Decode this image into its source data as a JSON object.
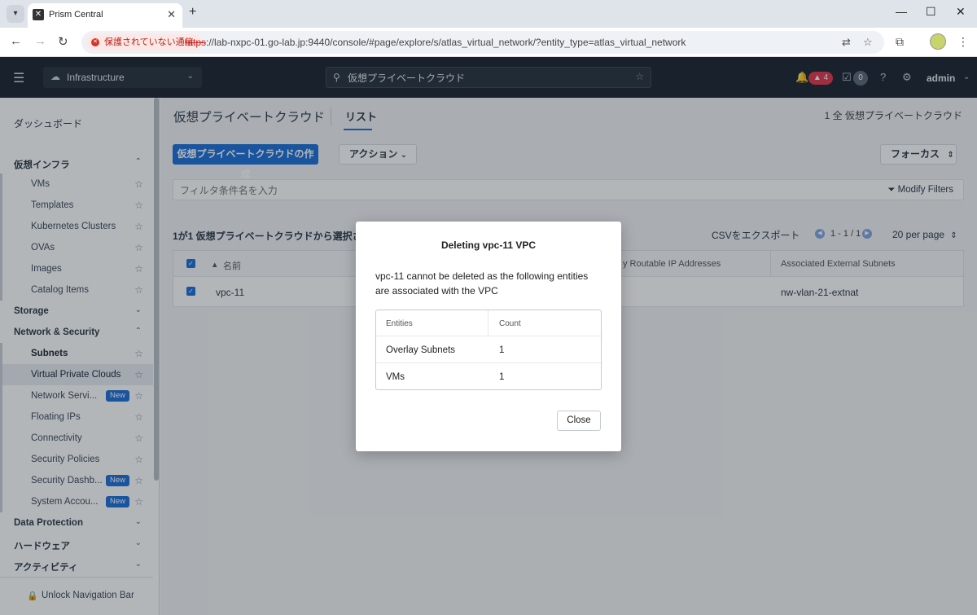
{
  "browser": {
    "tab_title": "Prism Central",
    "insecure_label": "保護されていない通信",
    "url_scheme": "https",
    "url_rest": "://lab-nxpc-01.go-lab.jp:9440/console/#page/explore/s/atlas_virtual_network/?entity_type=atlas_virtual_network"
  },
  "header": {
    "context": "Infrastructure",
    "search_value": "仮想プライベートクラウド",
    "alert_count": "4",
    "task_count": "0",
    "user": "admin"
  },
  "sidebar": {
    "dashboard": "ダッシュボード",
    "virt_section": "仮想インフラ",
    "virt_items": [
      "VMs",
      "Templates",
      "Kubernetes Clusters",
      "OVAs",
      "Images",
      "Catalog Items"
    ],
    "storage": "Storage",
    "netsec_section": "Network & Security",
    "netsec_items": [
      "Subnets",
      "Virtual Private Clouds",
      "Network Servi...",
      "Floating IPs",
      "Connectivity",
      "Security Policies",
      "Security Dashb...",
      "System Accou..."
    ],
    "new_badge": "New",
    "data_protection": "Data Protection",
    "hardware": "ハードウェア",
    "activity": "アクティビティ",
    "unlock": "Unlock Navigation Bar"
  },
  "main": {
    "title": "仮想プライベートクラウド",
    "tab": "リスト",
    "summary": "1 全 仮想プライベートクラウド",
    "create_button": "仮想プライベートクラウドの作成",
    "action_button": "アクション",
    "focus_button": "フォーカス",
    "filter_placeholder": "フィルタ条件名を入力",
    "modify_filters": "Modify Filters",
    "selection_text": "1が1 仮想プライベートクラウドから選択され",
    "csv": "CSVをエクスポート",
    "pager": "1 - 1 / 1",
    "per_page": "20 per page",
    "columns": [
      "名前",
      "y Routable IP Addresses",
      "Associated External Subnets"
    ],
    "row": {
      "name": "vpc-11",
      "ext_subnet": "nw-vlan-21-extnat"
    }
  },
  "modal": {
    "title": "Deleting vpc-11 VPC",
    "message": "vpc-11 cannot be deleted as the following entities are associated with the VPC",
    "header_entities": "Entities",
    "header_count": "Count",
    "rows": [
      {
        "entity": "Overlay Subnets",
        "count": "1"
      },
      {
        "entity": "VMs",
        "count": "1"
      }
    ],
    "close": "Close"
  }
}
